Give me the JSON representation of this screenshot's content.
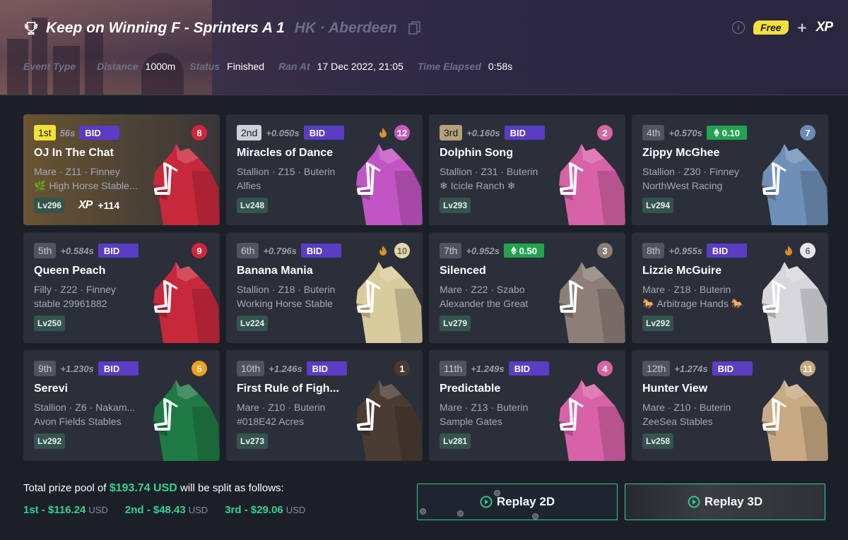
{
  "race": {
    "title": "Keep on Winning F - Sprinters A 1",
    "location": "HK · Aberdeen"
  },
  "header_right": {
    "free_label": "Free",
    "plus": "+",
    "xp_label": "XP"
  },
  "meta": [
    {
      "key": "Event Type",
      "value": ""
    },
    {
      "key": "Distance",
      "value": "1000m"
    },
    {
      "key": "Status",
      "value": "Finished"
    },
    {
      "key": "Ran At",
      "value": "17 Dec 2022, 21:05"
    },
    {
      "key": "Time Elapsed",
      "value": "0:58s"
    }
  ],
  "results": [
    {
      "pos": "1st",
      "gap": "56s",
      "tag": "BID",
      "gate": "8",
      "gate_color": "#d3243a",
      "hot": false,
      "name": "OJ In The Chat",
      "line1": "Mare · Z11 · Finney",
      "line2": "🌿 High Horse Stable...",
      "level": "Lv296",
      "xp_label": "XP",
      "xp_bonus": "+114",
      "coat": "#c8283c",
      "style": "gold"
    },
    {
      "pos": "2nd",
      "gap": "+0.050s",
      "tag": "BID",
      "gate": "12",
      "gate_color": "#c45bc4",
      "hot": true,
      "name": "Miracles of Dance",
      "line1": "Stallion · Z15 · Buterin",
      "line2": "Alfies",
      "level": "Lv248",
      "coat": "#c255c4",
      "style": "silver"
    },
    {
      "pos": "3rd",
      "gap": "+0.160s",
      "tag": "BID",
      "gate": "2",
      "gate_color": "#d964a5",
      "hot": false,
      "name": "Dolphin Song",
      "line1": "Stallion · Z31 · Buterin",
      "line2": "❄ Icicle Ranch ❄",
      "level": "Lv293",
      "coat": "#d862a8",
      "style": "bronze"
    },
    {
      "pos": "4th",
      "gap": "+0.570s",
      "tag": "0.10",
      "gate": "7",
      "gate_color": "#6b8ab8",
      "hot": false,
      "name": "Zippy McGhee",
      "line1": "Stallion · Z30 · Finney",
      "line2": "NorthWest Racing",
      "level": "Lv294",
      "coat": "#6e8fb8",
      "style": "plain"
    },
    {
      "pos": "5th",
      "gap": "+0.584s",
      "tag": "BID",
      "gate": "9",
      "gate_color": "#d3243a",
      "hot": false,
      "name": "Queen Peach",
      "line1": "Filly · Z22 · Finney",
      "line2": "stable 29961882",
      "level": "Lv250",
      "coat": "#c8283c",
      "style": "plain"
    },
    {
      "pos": "6th",
      "gap": "+0.796s",
      "tag": "BID",
      "gate": "10",
      "gate_color": "#e6d7a8",
      "hot": true,
      "name": "Banana Mania",
      "line1": "Stallion · Z18 · Buterin",
      "line2": "Working Horse Stable",
      "level": "Lv224",
      "coat": "#d9cc9c",
      "style": "plain"
    },
    {
      "pos": "7th",
      "gap": "+0.952s",
      "tag": "0.50",
      "gate": "3",
      "gate_color": "#8c7c76",
      "hot": false,
      "name": "Silenced",
      "line1": "Mare · Z22 · Szabo",
      "line2": "Alexander the Great",
      "level": "Lv279",
      "coat": "#8d7e78",
      "style": "plain"
    },
    {
      "pos": "8th",
      "gap": "+0.955s",
      "tag": "BID",
      "gate": "6",
      "gate_color": "#e8e8ec",
      "hot": true,
      "name": "Lizzie McGuire",
      "line1": "Mare · Z18 · Buterin",
      "line2": "🐎 Arbitrage Hands 🐎",
      "level": "Lv292",
      "coat": "#d8d8dc",
      "style": "plain"
    },
    {
      "pos": "9th",
      "gap": "+1.230s",
      "tag": "BID",
      "gate": "5",
      "gate_color": "#f0a21a",
      "hot": false,
      "name": "Serevi",
      "line1": "Stallion · Z6 · Nakam...",
      "line2": "Avon Fields Stables",
      "level": "Lv292",
      "coat": "#1f7a45",
      "style": "plain"
    },
    {
      "pos": "10th",
      "gap": "+1.246s",
      "tag": "BID",
      "gate": "1",
      "gate_color": "#4a3b30",
      "hot": false,
      "name": "First Rule of Figh...",
      "line1": "Mare · Z10 · Buterin",
      "line2": "#018E42 Acres",
      "level": "Lv273",
      "coat": "#4a3b33",
      "style": "plain"
    },
    {
      "pos": "11th",
      "gap": "+1.249s",
      "tag": "BID",
      "gate": "4",
      "gate_color": "#d964a5",
      "hot": false,
      "name": "Predictable",
      "line1": "Mare · Z13 · Buterin",
      "line2": "Sample Gates",
      "level": "Lv281",
      "coat": "#d862a8",
      "style": "plain"
    },
    {
      "pos": "12th",
      "gap": "+1.274s",
      "tag": "BID",
      "gate": "11",
      "gate_color": "#c9a880",
      "hot": false,
      "name": "Hunter View",
      "line1": "Mare · Z10 · Buterin",
      "line2": "ZeeSea Stables",
      "level": "Lv258",
      "coat": "#c9aa84",
      "style": "plain"
    }
  ],
  "prize": {
    "intro": "Total prize pool of",
    "amount": "$193.74 USD",
    "outro": "will be split as follows:",
    "splits": [
      {
        "label": "1st - $116.24",
        "currency": "USD"
      },
      {
        "label": "2nd - $48.43",
        "currency": "USD"
      },
      {
        "label": "3rd - $29.06",
        "currency": "USD"
      }
    ]
  },
  "replay": {
    "label_2d": "Replay 2D",
    "label_3d": "Replay 3D"
  },
  "colors": {
    "accent_green": "#2fd391",
    "bid_purple": "#5b3cc4",
    "eth_green": "#22a350",
    "free_yellow": "#f2e13a"
  }
}
